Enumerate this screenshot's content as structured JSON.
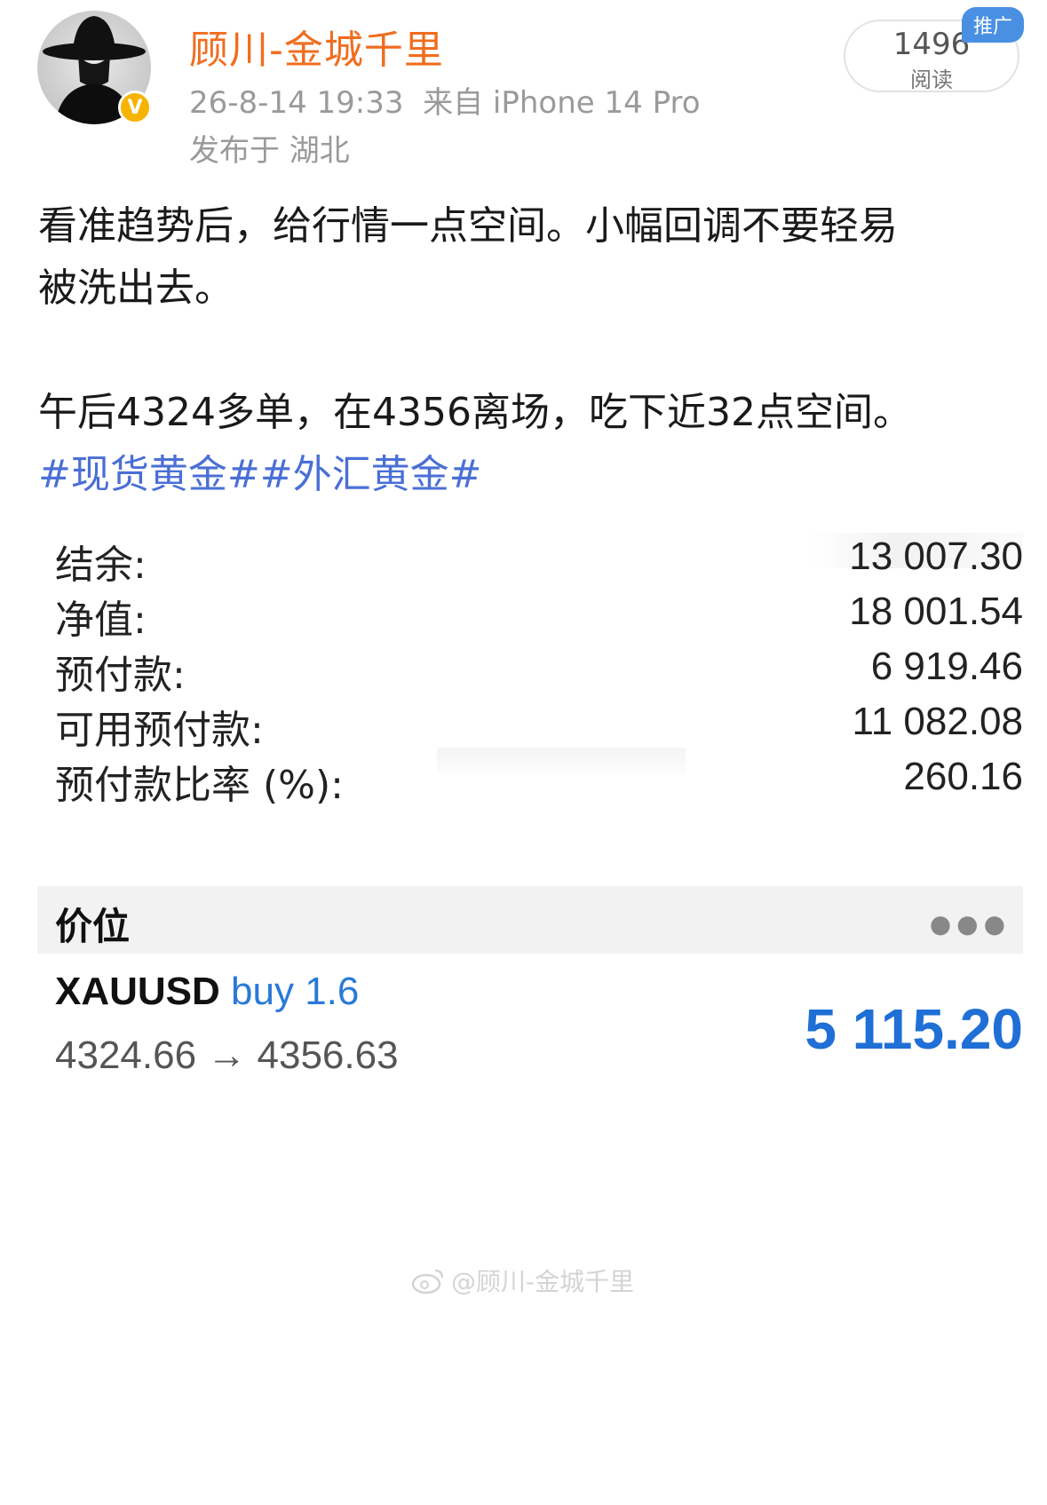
{
  "author": {
    "name": "顾川-金城千里",
    "verified_badge": "V",
    "timestamp": "26-8-14 19:33",
    "device": "来自 iPhone 14 Pro",
    "location": "发布于 湖北"
  },
  "reads": {
    "count": "1496",
    "label": "阅读",
    "promo_label": "推广"
  },
  "post": {
    "line1": "看准趋势后，给行情一点空间。小幅回调不要轻易",
    "line2": "被洗出去。",
    "line3": "午后4324多单，在4356离场，吃下近32点空间。",
    "hashtags": "#现货黄金##外汇黄金#"
  },
  "account": {
    "rows": [
      {
        "label": "结余:",
        "value": "13 007.30"
      },
      {
        "label": "净值:",
        "value": "18 001.54"
      },
      {
        "label": "预付款:",
        "value": "6 919.46"
      },
      {
        "label": "可用预付款:",
        "value": "11 082.08"
      },
      {
        "label": "预付款比率 (%):",
        "value": "260.16"
      }
    ]
  },
  "positions": {
    "title": "价位",
    "more_icon": "more-dots-icon",
    "symbol": "XAUUSD",
    "side": "buy 1.6",
    "price_range": "4324.66 → 4356.63",
    "profit": "5 115.20"
  },
  "watermark": "@顾川-金城千里",
  "colors": {
    "username": "#f06d1f",
    "hashtag": "#4a6fd6",
    "profit": "#1f6fd6",
    "buy": "#2a79d8",
    "verified": "#f5b400",
    "promo": "#4a90e2"
  }
}
